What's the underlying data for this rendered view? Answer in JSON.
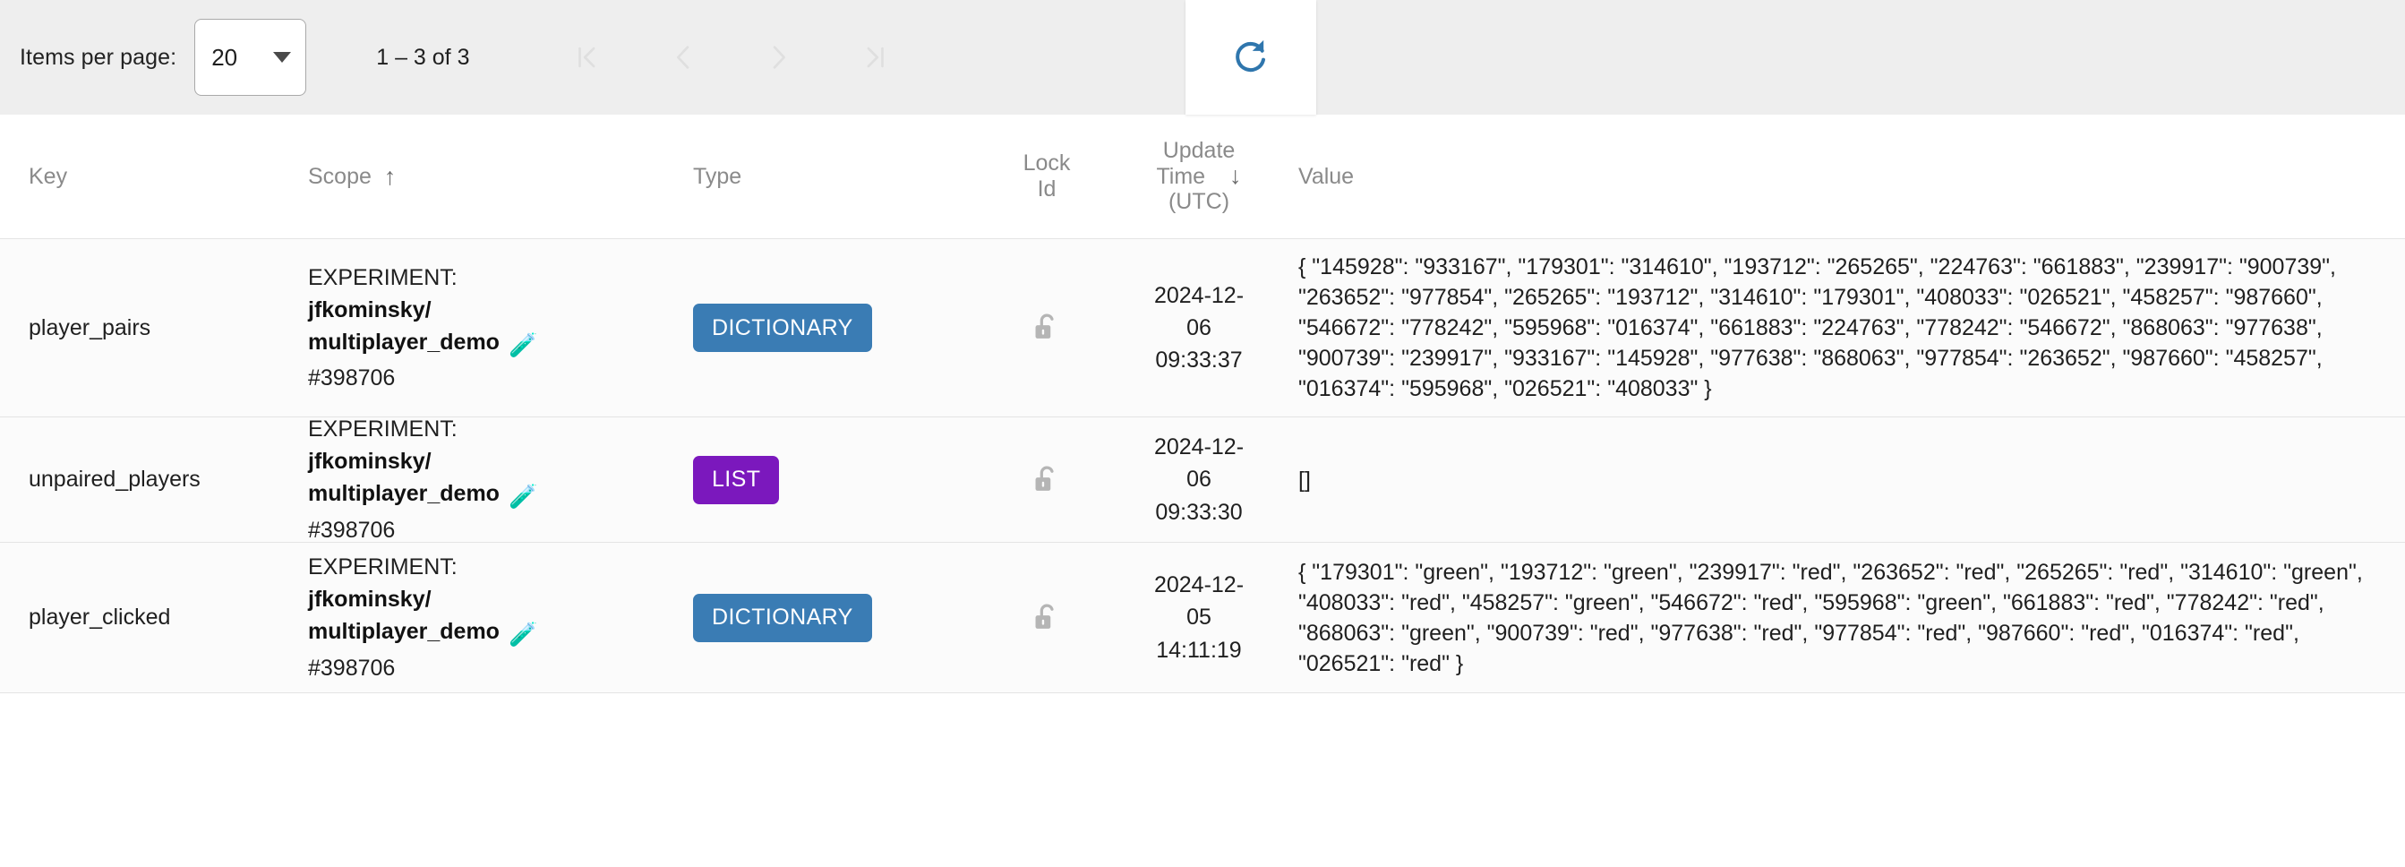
{
  "paginator": {
    "items_per_page_label": "Items per page:",
    "items_per_page_value": "20",
    "range_label": "1 – 3 of 3",
    "buttons": [
      {
        "name": "first-page-button",
        "icon": "first-page-icon",
        "disabled": true
      },
      {
        "name": "previous-page-button",
        "icon": "chevron-left-icon",
        "disabled": true
      },
      {
        "name": "next-page-button",
        "icon": "chevron-right-icon",
        "disabled": true
      },
      {
        "name": "last-page-button",
        "icon": "last-page-icon",
        "disabled": true
      }
    ],
    "refresh_icon": "refresh-icon",
    "refresh_color": "#2f76ad",
    "bar_background": "#eeeeee"
  },
  "table": {
    "columns": [
      {
        "key": "key",
        "label": "Key",
        "sort": ""
      },
      {
        "key": "scope",
        "label": "Scope",
        "sort": "↑"
      },
      {
        "key": "type",
        "label": "Type",
        "sort": ""
      },
      {
        "key": "lock_id",
        "label": "Lock\nId",
        "sort": ""
      },
      {
        "key": "update_time",
        "label": "Update\nTime\n(UTC)",
        "sort": "↓"
      },
      {
        "key": "value",
        "label": "Value",
        "sort": ""
      }
    ],
    "header_labels": {
      "key": "Key",
      "scope": "Scope",
      "scope_sort": "↑",
      "type": "Type",
      "lock_id_line1": "Lock",
      "lock_id_line2": "Id",
      "update_time_line1": "Update",
      "update_time_line2": "Time",
      "update_time_sort": "↓",
      "update_time_line3": "(UTC)",
      "value": "Value"
    },
    "rows": [
      {
        "key": "player_pairs",
        "scope_prefix": "EXPERIMENT:",
        "scope_name": "jfkominsky/ multiplayer_demo",
        "scope_name_line1": "jfkominsky/",
        "scope_name_line2": "multiplayer_demo",
        "scope_id": "#398706",
        "scope_icon": "flask-icon",
        "type": "DICTIONARY",
        "type_color": "#3a7cb4",
        "lock_icon": "unlocked-padlock-icon",
        "update_time": "2024-12-\n06\n09:33:37",
        "value": "{ \"145928\": \"933167\", \"179301\": \"314610\", \"193712\": \"265265\", \"224763\": \"661883\", \"239917\": \"900739\", \"263652\": \"977854\", \"265265\": \"193712\", \"314610\": \"179301\", \"408033\": \"026521\", \"458257\": \"987660\", \"546672\": \"778242\", \"595968\": \"016374\", \"661883\": \"224763\", \"778242\": \"546672\", \"868063\": \"977638\", \"900739\": \"239917\", \"933167\": \"145928\", \"977638\": \"868063\", \"977854\": \"263652\", \"987660\": \"458257\", \"016374\": \"595968\", \"026521\": \"408033\" }"
      },
      {
        "key": "unpaired_players",
        "scope_prefix": "EXPERIMENT:",
        "scope_name": "jfkominsky/ multiplayer_demo",
        "scope_name_line1": "jfkominsky/",
        "scope_name_line2": "multiplayer_demo",
        "scope_id": "#398706",
        "scope_icon": "flask-icon",
        "type": "LIST",
        "type_color": "#7b18bd",
        "lock_icon": "unlocked-padlock-icon",
        "update_time": "2024-12-\n06\n09:33:30",
        "value": "[]"
      },
      {
        "key": "player_clicked",
        "scope_prefix": "EXPERIMENT:",
        "scope_name": "jfkominsky/ multiplayer_demo",
        "scope_name_line1": "jfkominsky/",
        "scope_name_line2": "multiplayer_demo",
        "scope_id": "#398706",
        "scope_icon": "flask-icon",
        "type": "DICTIONARY",
        "type_color": "#3a7cb4",
        "lock_icon": "unlocked-padlock-icon",
        "update_time": "2024-12-\n05\n14:11:19",
        "value": "{ \"179301\": \"green\", \"193712\": \"green\", \"239917\": \"red\", \"263652\": \"red\", \"265265\": \"red\", \"314610\": \"green\", \"408033\": \"red\", \"458257\": \"green\", \"546672\": \"red\", \"595968\": \"green\", \"661883\": \"red\", \"778242\": \"red\", \"868063\": \"green\", \"900739\": \"red\", \"977638\": \"red\", \"977854\": \"red\", \"987660\": \"red\", \"016374\": \"red\", \"026521\": \"red\" }"
      }
    ]
  }
}
